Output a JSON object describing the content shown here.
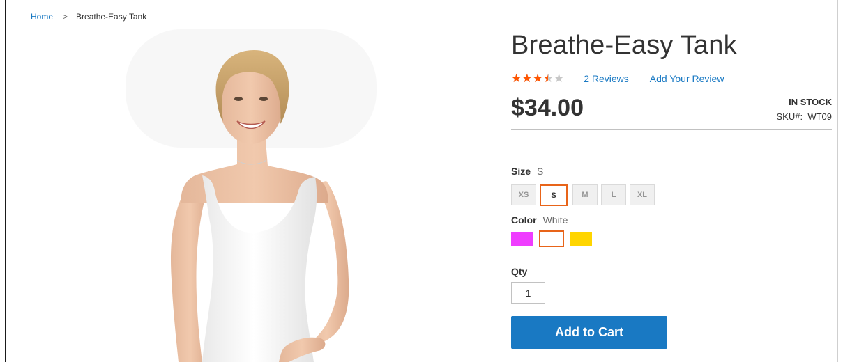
{
  "breadcrumb": {
    "home": "Home",
    "separator": ">",
    "current": "Breathe-Easy Tank"
  },
  "product": {
    "title": "Breathe-Easy Tank",
    "rating_stars_filled": 3.5,
    "rating_stars_total": 5,
    "reviews_link": "2  Reviews",
    "add_review_link": "Add Your Review",
    "price": "$34.00",
    "stock": "IN STOCK",
    "sku_label": "SKU#:",
    "sku_value": "WT09",
    "sku_text": "SKU#:  WT09"
  },
  "size": {
    "label": "Size",
    "selected": "S",
    "options": [
      "XS",
      "S",
      "M",
      "L",
      "XL"
    ]
  },
  "color": {
    "label": "Color",
    "selected": "White",
    "options": [
      {
        "name": "Purple",
        "hex": "#ef3dff"
      },
      {
        "name": "White",
        "hex": "#ffffff"
      },
      {
        "name": "Yellow",
        "hex": "#ffd500"
      }
    ]
  },
  "qty": {
    "label": "Qty",
    "value": "1"
  },
  "cart": {
    "button_label": "Add to Cart"
  },
  "colors": {
    "accent": "#1979c3",
    "star": "#ff5501",
    "selected_border": "#e86419"
  }
}
